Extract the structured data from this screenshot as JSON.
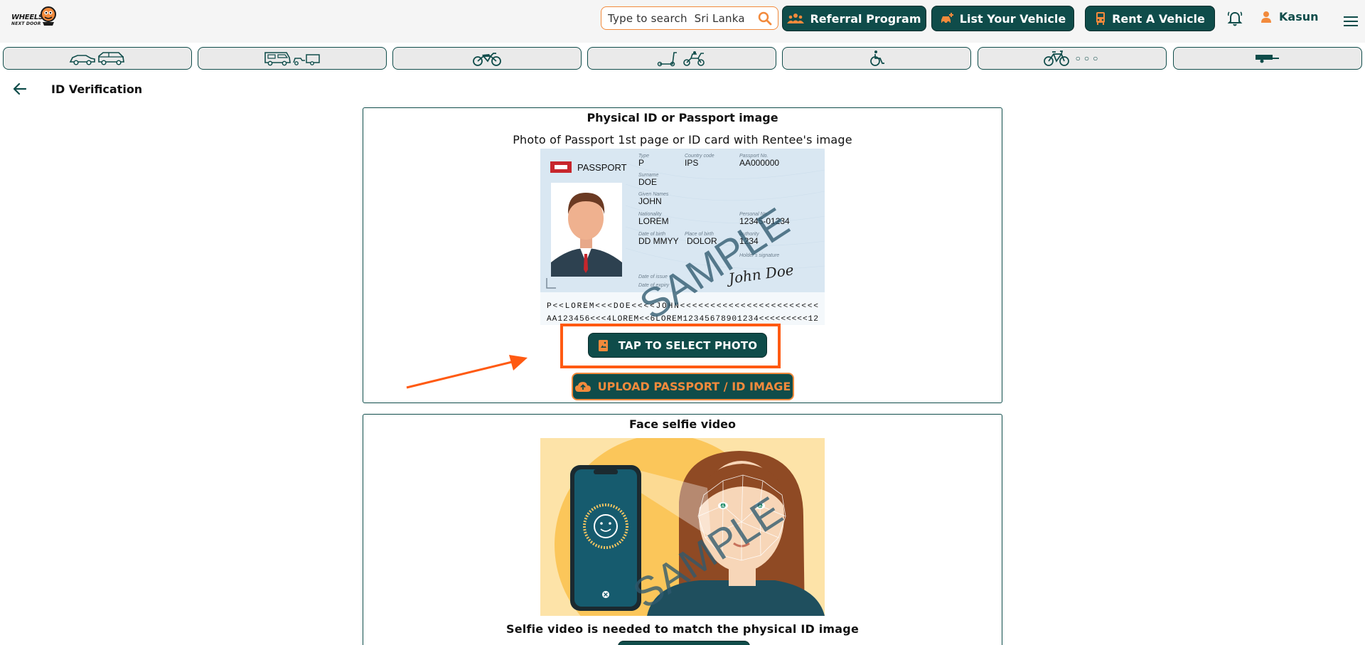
{
  "header": {
    "logo_line1": "WHEELS",
    "logo_line2": "NEXT DOOR",
    "search_placeholder": "Type to search  Sri Lanka",
    "referral_label": "Referral Program",
    "list_vehicle_label": "List Your Vehicle",
    "rent_vehicle_label": "Rent A Vehicle",
    "user_name": "Kasun",
    "brand_color": "#0f4c4a",
    "accent_color": "#f28a3c"
  },
  "categories": [
    {
      "name": "cars",
      "icon": "car-icon"
    },
    {
      "name": "campers",
      "icon": "campervan-icon"
    },
    {
      "name": "motorbikes",
      "icon": "motorbike-icon"
    },
    {
      "name": "scooters",
      "icon": "scooter-icon"
    },
    {
      "name": "mobility",
      "icon": "wheelchair-icon"
    },
    {
      "name": "bicycles",
      "icon": "bicycle-icon",
      "dots": "○○○"
    },
    {
      "name": "trailers",
      "icon": "trailer-icon"
    }
  ],
  "page": {
    "title": "ID Verification"
  },
  "id_card": {
    "heading": "Physical ID or Passport image",
    "subheading": "Photo of Passport 1st page or ID card with Rentee's image",
    "select_button": "TAP TO SELECT PHOTO",
    "upload_button": "UPLOAD PASSPORT / ID IMAGE",
    "sample": {
      "doc_title": "PASSPORT",
      "type_label": "Type",
      "type": "P",
      "country_label": "Country code",
      "country": "IPS",
      "passport_no_label": "Passport No.",
      "passport_no": "AA000000",
      "surname_label": "Surname",
      "surname": "DOE",
      "given_label": "Given Names",
      "given": "JOHN",
      "nationality_label": "Nationality",
      "nationality": "LOREM",
      "personal_no_label": "Personal No.",
      "personal_no": "12345-01234",
      "dob_label": "Date of birth",
      "dob": "DD MMYY",
      "pob_label": "Place of birth",
      "pob": "DOLOR",
      "authority_label": "Authority",
      "authority": "1234",
      "signature_label": "Holder's signature",
      "signature": "John Doe",
      "issue_label": "Date of issue",
      "expiry_label": "Date of expiry",
      "mrz1": "P<<LOREM<<<DOE<<<<JOHN<<<<<<<<<<<<<<<<<<<<<<<",
      "mrz2": "AA123456<<<4LOREM<<6LOREM12345678901234<<<<<<<<<12",
      "watermark": "SAMPLE"
    }
  },
  "selfie": {
    "heading": "Face selfie video",
    "watermark": "SAMPLE",
    "caption": "Selfie video is needed to match the physical ID image"
  }
}
